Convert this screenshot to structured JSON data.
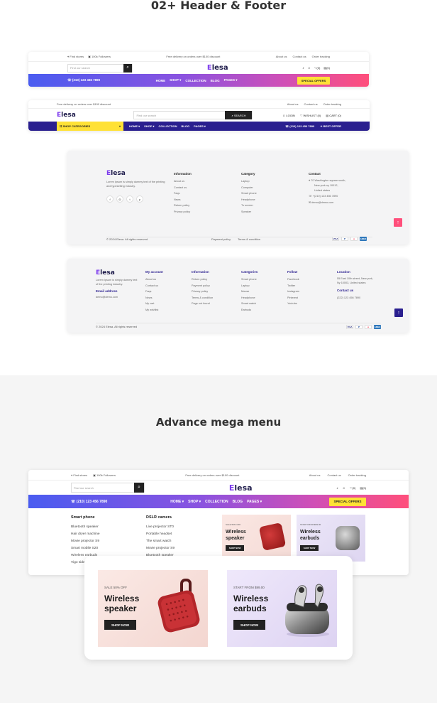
{
  "sections": {
    "header_footer_title": "02+ Header & Footer",
    "mega_menu_title": "Advance mega menu"
  },
  "header1": {
    "find_stores": "Find stores",
    "followers": "100k Followers",
    "promo": "Free delivery on orders over $100 discount",
    "links": [
      "About us",
      "Contact us",
      "Order tracking"
    ],
    "search_placeholder": "Find our search",
    "logo_prefix": "E",
    "logo_rest": "lesa",
    "wishlist": "(0)",
    "cart": "(0)",
    "phone": "(210) 123 456 7890",
    "nav": [
      "HOME",
      "SHOP",
      "COLLECTION",
      "BLOG",
      "PAGES"
    ],
    "offer": "SPECIAL OFFERS"
  },
  "header2": {
    "promo": "Free delivery on orders over $100 discount",
    "links": [
      "About us",
      "Contact us",
      "Order tracking"
    ],
    "search_placeholder": "Find our search",
    "search_button": "SEARCH",
    "login": "LOGIN",
    "wishlist": "WISHLIST (0)",
    "cart": "CART (0)",
    "categories": "SHOP CATEGORIES",
    "nav": [
      "HOME",
      "SHOP",
      "COLLECTION",
      "BLOG",
      "PAGES"
    ],
    "phone": "(210) 123 456 7890",
    "best_offer": "BEST OFFER"
  },
  "footer1": {
    "about": "Lorem Ipsum is simply dummy text of the printing and typesetting industry.",
    "info_title": "Information",
    "info_links": [
      "About us",
      "Contact us",
      "Faqs",
      "News",
      "Return policy",
      "Privacy policy"
    ],
    "cat_title": "Category",
    "cat_links": [
      "Laptop",
      "Computer",
      "Smart phone",
      "Headphone",
      "Tv screen",
      "Speaker"
    ],
    "contact_title": "Contact",
    "address": [
      "70 Washington square south,",
      "New york ny 10012,",
      "United states"
    ],
    "phone": "+(210) 123 456 7890",
    "email": "demo@demo.com",
    "copyright": "© 2024 Elesa. All rights reserved",
    "bottom_links": [
      "Payment policy",
      "Terms & condition"
    ],
    "accent": "#ff4f7b"
  },
  "footer2": {
    "about": "Lorem Ipsum is simply dummy text of the printing industry.",
    "email_title": "Email address",
    "email": "demo@demo.com",
    "account_title": "My account",
    "account_links": [
      "About us",
      "Contact us",
      "Faqs",
      "News",
      "My cart",
      "My wishlist"
    ],
    "info_title": "Information",
    "info_links": [
      "Return policy",
      "Payment policy",
      "Privacy policy",
      "Terms & condition",
      "Page not found"
    ],
    "cat_title": "Categories",
    "cat_links": [
      "Smart phone",
      "Laptop",
      "Mouse",
      "Headphone",
      "Smart watch",
      "Earbuds"
    ],
    "follow_title": "Follow",
    "follow_links": [
      "Facebook",
      "Twitter",
      "Instagram",
      "Pinterest",
      "Youtube"
    ],
    "location_title": "Location",
    "location": [
      "55 East 10th street, New york,",
      "Ny 10003, United states"
    ],
    "contact_title": "Contact us",
    "contact_phone": "(222) 123 456 7890",
    "copyright": "© 2024 Elesa. All rights reserved",
    "accent": "#2a1f8f"
  },
  "mega": {
    "col1_title": "Smart phone",
    "col1": [
      "Bluetooth speaker",
      "Hair dryer machine",
      "Movie projector S9",
      "Smart mobile S20",
      "Wireless earbuds",
      "Vigo side"
    ],
    "col2_title": "DSLR camera",
    "col2": [
      "Live projector ST0",
      "Portable headset",
      "The smart watch",
      "Movie projector S9",
      "Bluetooth speaker"
    ]
  },
  "banners": {
    "speaker_tag": "SALE 50% OFF",
    "speaker_title": [
      "Wireless",
      "speaker"
    ],
    "earbuds_tag": "START FROM $99.00",
    "earbuds_title": [
      "Wireless",
      "earbuds"
    ],
    "button": "SHOP NOW"
  },
  "payments": [
    "VISA",
    "P",
    "MC",
    "AMEX"
  ]
}
